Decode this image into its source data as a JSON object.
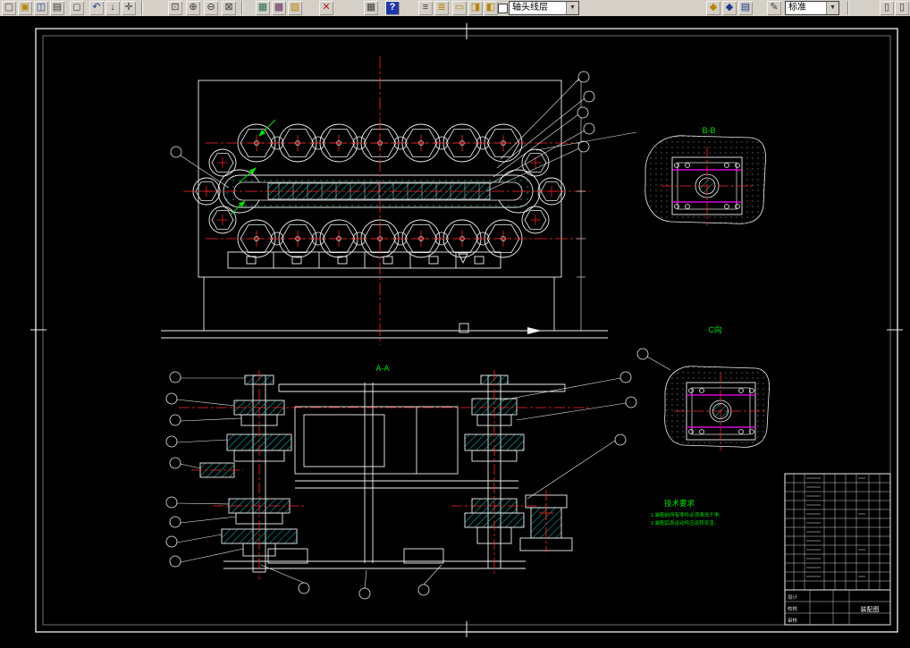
{
  "toolbar": {
    "dropdown_glyph": "▼",
    "layer_combo": {
      "value": "轴头线层"
    },
    "style_combo": {
      "value": "标准"
    },
    "icons": [
      {
        "name": "new-file-icon",
        "glyph": "▢"
      },
      {
        "name": "open-file-icon",
        "glyph": "▣"
      },
      {
        "name": "save-file-icon",
        "glyph": "◫"
      },
      {
        "name": "print-icon",
        "glyph": "▤"
      },
      {
        "name": "print-preview-icon",
        "glyph": "◻"
      },
      {
        "name": "undo-icon",
        "glyph": "↶"
      },
      {
        "name": "down-arrow-icon",
        "glyph": "↓"
      },
      {
        "name": "pan-icon",
        "glyph": "✛"
      },
      {
        "name": "zoom-window-icon",
        "glyph": "⊡"
      },
      {
        "name": "zoom-in-icon",
        "glyph": "⊕"
      },
      {
        "name": "zoom-out-icon",
        "glyph": "⊖"
      },
      {
        "name": "zoom-extents-icon",
        "glyph": "⊠"
      },
      {
        "name": "image-icon-1",
        "glyph": "▦"
      },
      {
        "name": "image-icon-2",
        "glyph": "▩"
      },
      {
        "name": "image-icon-3",
        "glyph": "▨"
      },
      {
        "name": "erase-icon",
        "glyph": "✕"
      },
      {
        "name": "table-grid-icon",
        "glyph": "▦"
      },
      {
        "name": "help-icon",
        "glyph": "?"
      },
      {
        "name": "layers-icon",
        "glyph": "≡"
      },
      {
        "name": "layer-props-icon",
        "glyph": "≣"
      },
      {
        "name": "yellow-frame-icon",
        "glyph": "▭"
      },
      {
        "name": "yellow-page-icon",
        "glyph": "◨"
      },
      {
        "name": "yellow-layer-icon",
        "glyph": "◧"
      },
      {
        "name": "gold-gem-icon",
        "glyph": "◆"
      },
      {
        "name": "blue-gem-icon",
        "glyph": "◆"
      },
      {
        "name": "palette-icon",
        "glyph": "▤"
      },
      {
        "name": "pencil-icon",
        "glyph": "✎"
      },
      {
        "name": "doc-icon-1",
        "glyph": "▯"
      },
      {
        "name": "doc-icon-2",
        "glyph": "▯"
      }
    ]
  },
  "drawing": {
    "view_labels": {
      "section_bb": "B-B",
      "view_c": "C向",
      "section_aa": "A-A"
    },
    "notes": {
      "title": "技术要求",
      "line1": "1.装配前所有零件必须清洗干净;",
      "line2": "2.装配后各运动件应运转灵活。"
    },
    "title_block": {
      "designer_label": "设计",
      "checker_label": "校核",
      "auditor_label": "审核",
      "drawing_name": "装配图"
    },
    "colors": {
      "centerline": "#ff2a2a",
      "outline": "#f0f0f0",
      "hatch": "#00c8c8",
      "section_line": "#ff00ff",
      "annotation": "#00e000"
    }
  }
}
